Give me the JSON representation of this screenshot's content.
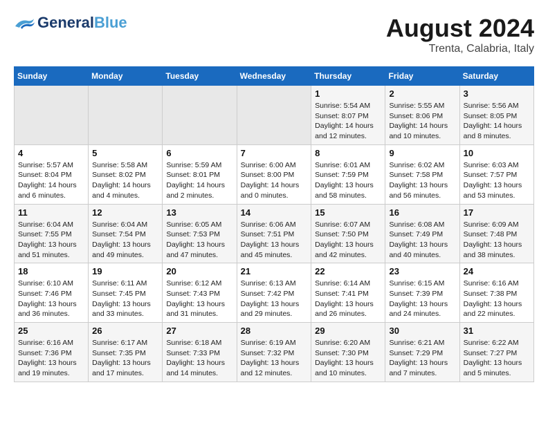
{
  "header": {
    "logo_general": "General",
    "logo_blue": "Blue",
    "month_year": "August 2024",
    "location": "Trenta, Calabria, Italy"
  },
  "weekdays": [
    "Sunday",
    "Monday",
    "Tuesday",
    "Wednesday",
    "Thursday",
    "Friday",
    "Saturday"
  ],
  "weeks": [
    [
      {
        "day": "",
        "sunrise": "",
        "sunset": "",
        "daylight": ""
      },
      {
        "day": "",
        "sunrise": "",
        "sunset": "",
        "daylight": ""
      },
      {
        "day": "",
        "sunrise": "",
        "sunset": "",
        "daylight": ""
      },
      {
        "day": "",
        "sunrise": "",
        "sunset": "",
        "daylight": ""
      },
      {
        "day": "1",
        "sunrise": "Sunrise: 5:54 AM",
        "sunset": "Sunset: 8:07 PM",
        "daylight": "Daylight: 14 hours and 12 minutes."
      },
      {
        "day": "2",
        "sunrise": "Sunrise: 5:55 AM",
        "sunset": "Sunset: 8:06 PM",
        "daylight": "Daylight: 14 hours and 10 minutes."
      },
      {
        "day": "3",
        "sunrise": "Sunrise: 5:56 AM",
        "sunset": "Sunset: 8:05 PM",
        "daylight": "Daylight: 14 hours and 8 minutes."
      }
    ],
    [
      {
        "day": "4",
        "sunrise": "Sunrise: 5:57 AM",
        "sunset": "Sunset: 8:04 PM",
        "daylight": "Daylight: 14 hours and 6 minutes."
      },
      {
        "day": "5",
        "sunrise": "Sunrise: 5:58 AM",
        "sunset": "Sunset: 8:02 PM",
        "daylight": "Daylight: 14 hours and 4 minutes."
      },
      {
        "day": "6",
        "sunrise": "Sunrise: 5:59 AM",
        "sunset": "Sunset: 8:01 PM",
        "daylight": "Daylight: 14 hours and 2 minutes."
      },
      {
        "day": "7",
        "sunrise": "Sunrise: 6:00 AM",
        "sunset": "Sunset: 8:00 PM",
        "daylight": "Daylight: 14 hours and 0 minutes."
      },
      {
        "day": "8",
        "sunrise": "Sunrise: 6:01 AM",
        "sunset": "Sunset: 7:59 PM",
        "daylight": "Daylight: 13 hours and 58 minutes."
      },
      {
        "day": "9",
        "sunrise": "Sunrise: 6:02 AM",
        "sunset": "Sunset: 7:58 PM",
        "daylight": "Daylight: 13 hours and 56 minutes."
      },
      {
        "day": "10",
        "sunrise": "Sunrise: 6:03 AM",
        "sunset": "Sunset: 7:57 PM",
        "daylight": "Daylight: 13 hours and 53 minutes."
      }
    ],
    [
      {
        "day": "11",
        "sunrise": "Sunrise: 6:04 AM",
        "sunset": "Sunset: 7:55 PM",
        "daylight": "Daylight: 13 hours and 51 minutes."
      },
      {
        "day": "12",
        "sunrise": "Sunrise: 6:04 AM",
        "sunset": "Sunset: 7:54 PM",
        "daylight": "Daylight: 13 hours and 49 minutes."
      },
      {
        "day": "13",
        "sunrise": "Sunrise: 6:05 AM",
        "sunset": "Sunset: 7:53 PM",
        "daylight": "Daylight: 13 hours and 47 minutes."
      },
      {
        "day": "14",
        "sunrise": "Sunrise: 6:06 AM",
        "sunset": "Sunset: 7:51 PM",
        "daylight": "Daylight: 13 hours and 45 minutes."
      },
      {
        "day": "15",
        "sunrise": "Sunrise: 6:07 AM",
        "sunset": "Sunset: 7:50 PM",
        "daylight": "Daylight: 13 hours and 42 minutes."
      },
      {
        "day": "16",
        "sunrise": "Sunrise: 6:08 AM",
        "sunset": "Sunset: 7:49 PM",
        "daylight": "Daylight: 13 hours and 40 minutes."
      },
      {
        "day": "17",
        "sunrise": "Sunrise: 6:09 AM",
        "sunset": "Sunset: 7:48 PM",
        "daylight": "Daylight: 13 hours and 38 minutes."
      }
    ],
    [
      {
        "day": "18",
        "sunrise": "Sunrise: 6:10 AM",
        "sunset": "Sunset: 7:46 PM",
        "daylight": "Daylight: 13 hours and 36 minutes."
      },
      {
        "day": "19",
        "sunrise": "Sunrise: 6:11 AM",
        "sunset": "Sunset: 7:45 PM",
        "daylight": "Daylight: 13 hours and 33 minutes."
      },
      {
        "day": "20",
        "sunrise": "Sunrise: 6:12 AM",
        "sunset": "Sunset: 7:43 PM",
        "daylight": "Daylight: 13 hours and 31 minutes."
      },
      {
        "day": "21",
        "sunrise": "Sunrise: 6:13 AM",
        "sunset": "Sunset: 7:42 PM",
        "daylight": "Daylight: 13 hours and 29 minutes."
      },
      {
        "day": "22",
        "sunrise": "Sunrise: 6:14 AM",
        "sunset": "Sunset: 7:41 PM",
        "daylight": "Daylight: 13 hours and 26 minutes."
      },
      {
        "day": "23",
        "sunrise": "Sunrise: 6:15 AM",
        "sunset": "Sunset: 7:39 PM",
        "daylight": "Daylight: 13 hours and 24 minutes."
      },
      {
        "day": "24",
        "sunrise": "Sunrise: 6:16 AM",
        "sunset": "Sunset: 7:38 PM",
        "daylight": "Daylight: 13 hours and 22 minutes."
      }
    ],
    [
      {
        "day": "25",
        "sunrise": "Sunrise: 6:16 AM",
        "sunset": "Sunset: 7:36 PM",
        "daylight": "Daylight: 13 hours and 19 minutes."
      },
      {
        "day": "26",
        "sunrise": "Sunrise: 6:17 AM",
        "sunset": "Sunset: 7:35 PM",
        "daylight": "Daylight: 13 hours and 17 minutes."
      },
      {
        "day": "27",
        "sunrise": "Sunrise: 6:18 AM",
        "sunset": "Sunset: 7:33 PM",
        "daylight": "Daylight: 13 hours and 14 minutes."
      },
      {
        "day": "28",
        "sunrise": "Sunrise: 6:19 AM",
        "sunset": "Sunset: 7:32 PM",
        "daylight": "Daylight: 13 hours and 12 minutes."
      },
      {
        "day": "29",
        "sunrise": "Sunrise: 6:20 AM",
        "sunset": "Sunset: 7:30 PM",
        "daylight": "Daylight: 13 hours and 10 minutes."
      },
      {
        "day": "30",
        "sunrise": "Sunrise: 6:21 AM",
        "sunset": "Sunset: 7:29 PM",
        "daylight": "Daylight: 13 hours and 7 minutes."
      },
      {
        "day": "31",
        "sunrise": "Sunrise: 6:22 AM",
        "sunset": "Sunset: 7:27 PM",
        "daylight": "Daylight: 13 hours and 5 minutes."
      }
    ]
  ]
}
